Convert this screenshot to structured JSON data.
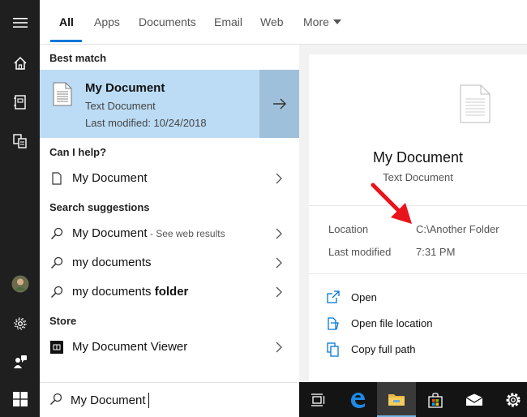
{
  "tabs": [
    {
      "label": "All"
    },
    {
      "label": "Apps"
    },
    {
      "label": "Documents"
    },
    {
      "label": "Email"
    },
    {
      "label": "Web"
    },
    {
      "label": "More"
    }
  ],
  "sections": {
    "best_match": "Best match",
    "can_i_help": "Can I help?",
    "search_suggestions": "Search suggestions",
    "store": "Store"
  },
  "best_match": {
    "title": "My Document",
    "type": "Text Document",
    "modified": "Last modified: 10/24/2018"
  },
  "help_item": {
    "label": "My Document"
  },
  "suggestions": [
    {
      "prefix": "My Document",
      "bold": "",
      "hint": " - See web results"
    },
    {
      "prefix": "my documents",
      "bold": "",
      "hint": ""
    },
    {
      "prefix": "my documents ",
      "bold": "folder",
      "hint": ""
    }
  ],
  "store_item": {
    "label": "My Document Viewer"
  },
  "search": {
    "value": "My Document"
  },
  "preview": {
    "title": "My Document",
    "type": "Text Document",
    "location_label": "Location",
    "location_value": "C:\\Another Folder",
    "modified_label": "Last modified",
    "modified_value": "7:31 PM",
    "actions": [
      {
        "label": "Open"
      },
      {
        "label": "Open file location"
      },
      {
        "label": "Copy full path"
      }
    ]
  },
  "colors": {
    "accent": "#0078d7",
    "best_bg": "#bcdcf5",
    "arrow_panel": "#9fc0da",
    "annotation": "#e8141c"
  },
  "icons": {
    "rail": [
      "hamburger-icon",
      "home-icon",
      "notebook-icon",
      "documents-icon",
      "avatar",
      "settings-icon",
      "feedback-icon",
      "windows-icon"
    ],
    "taskbar": [
      "task-view-icon",
      "edge-icon",
      "file-explorer-icon",
      "store-icon",
      "mail-icon",
      "settings-icon"
    ]
  }
}
